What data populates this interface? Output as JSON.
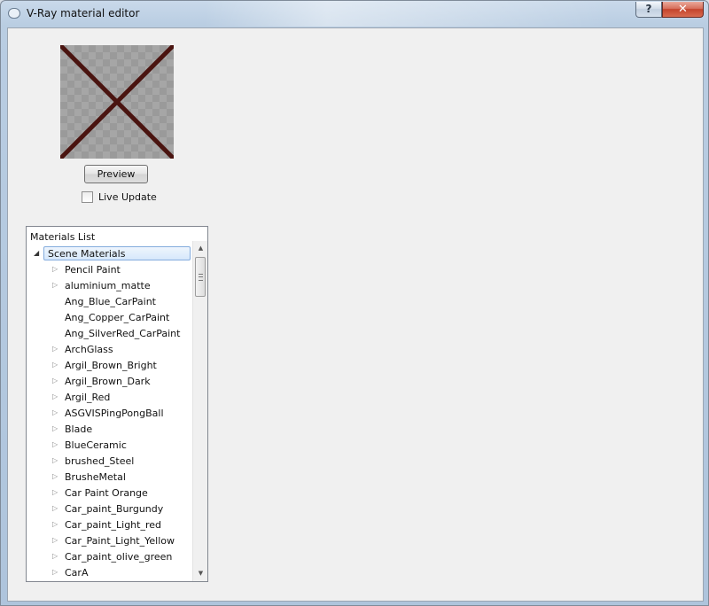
{
  "window": {
    "title": "V-Ray material editor",
    "help_label": "?",
    "close_label": "✕"
  },
  "preview": {
    "button_label": "Preview",
    "live_update_label": "Live Update",
    "live_update_checked": false
  },
  "materials_list": {
    "header": "Materials List",
    "root": {
      "label": "Scene Materials",
      "expanded": true,
      "selected": true
    },
    "items": [
      {
        "label": " Pencil Paint",
        "has_children": true
      },
      {
        "label": "aluminium_matte",
        "has_children": true
      },
      {
        "label": "Ang_Blue_CarPaint",
        "has_children": false
      },
      {
        "label": "Ang_Copper_CarPaint",
        "has_children": false
      },
      {
        "label": "Ang_SilverRed_CarPaint",
        "has_children": false
      },
      {
        "label": "ArchGlass",
        "has_children": true
      },
      {
        "label": "Argil_Brown_Bright",
        "has_children": true
      },
      {
        "label": "Argil_Brown_Dark",
        "has_children": true
      },
      {
        "label": "Argil_Red",
        "has_children": true
      },
      {
        "label": "ASGVISPingPongBall",
        "has_children": true
      },
      {
        "label": "Blade",
        "has_children": true
      },
      {
        "label": "BlueCeramic",
        "has_children": true
      },
      {
        "label": "brushed_Steel",
        "has_children": true
      },
      {
        "label": "BrusheMetal",
        "has_children": true
      },
      {
        "label": "Car Paint Orange",
        "has_children": true
      },
      {
        "label": "Car_paint_Burgundy",
        "has_children": true
      },
      {
        "label": "Car_paint_Light_red",
        "has_children": true
      },
      {
        "label": "Car_Paint_Light_Yellow",
        "has_children": true
      },
      {
        "label": "Car_paint_olive_green",
        "has_children": true
      },
      {
        "label": "CarA",
        "has_children": true
      }
    ]
  },
  "icons": {
    "expanded": "expanded-triangle-icon",
    "collapsed": "collapsed-triangle-icon"
  },
  "colors": {
    "preview_cross": "#4a1410",
    "selection_border": "#84acdd"
  }
}
